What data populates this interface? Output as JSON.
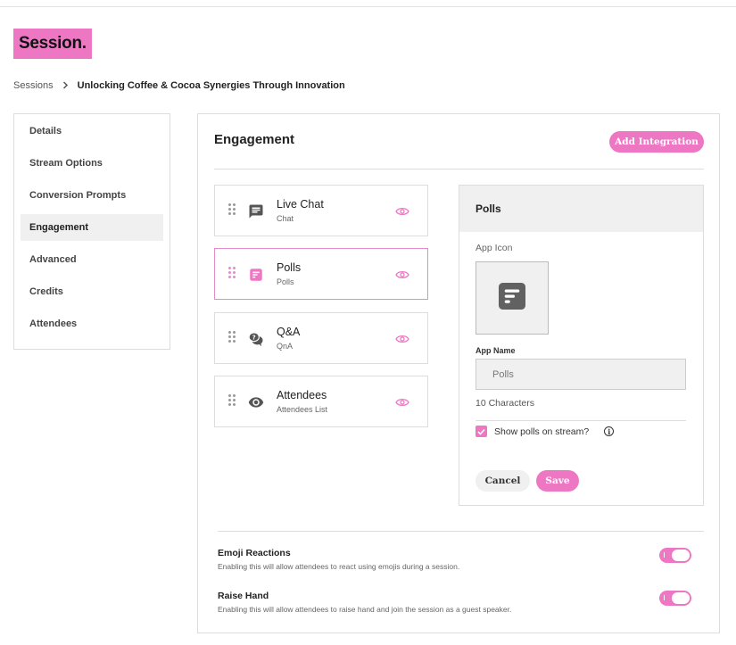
{
  "brand": {
    "logo_text": "Session.",
    "accent_color": "#ee77c4"
  },
  "breadcrumb": {
    "root": "Sessions",
    "separator_icon": "chevron-right-icon",
    "current": "Unlocking Coffee & Cocoa Synergies Through Innovation"
  },
  "sidebar": {
    "items": [
      {
        "label": "Details"
      },
      {
        "label": "Stream Options"
      },
      {
        "label": "Conversion Prompts"
      },
      {
        "label": "Engagement",
        "active": true
      },
      {
        "label": "Advanced"
      },
      {
        "label": "Credits"
      },
      {
        "label": "Attendees"
      }
    ]
  },
  "engagement": {
    "title": "Engagement",
    "add_integration_label": "Add Integration",
    "apps": [
      {
        "name": "Live Chat",
        "subtitle": "Chat",
        "icon": "chat-icon",
        "visibility_icon": "eye-icon"
      },
      {
        "name": "Polls",
        "subtitle": "Polls",
        "icon": "poll-icon",
        "visibility_icon": "eye-icon",
        "selected": true
      },
      {
        "name": "Q&A",
        "subtitle": "QnA",
        "icon": "question-answer-icon",
        "visibility_icon": "eye-icon"
      },
      {
        "name": "Attendees",
        "subtitle": "Attendees List",
        "icon": "eye-icon",
        "visibility_icon": "eye-icon"
      }
    ],
    "details": {
      "title": "Polls",
      "app_icon_label": "App Icon",
      "app_name_label": "App Name",
      "app_name_value": "Polls",
      "char_count": "10 Characters",
      "show_label": "Show polls on stream?",
      "show_checked": true,
      "cancel_label": "Cancel",
      "save_label": "Save"
    },
    "settings": [
      {
        "title": "Emoji Reactions",
        "description": "Enabling this will allow attendees to react using emojis during a session.",
        "enabled": true
      },
      {
        "title": "Raise Hand",
        "description": "Enabling this will allow attendees to raise hand and join the session as a guest speaker.",
        "enabled": true
      }
    ]
  }
}
